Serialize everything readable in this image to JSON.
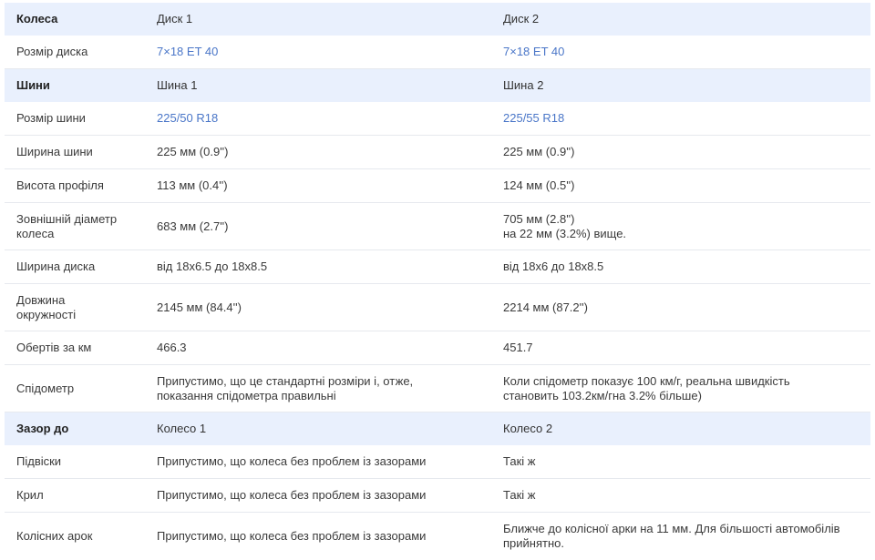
{
  "colors": {
    "header_bg": "#e9f0fd",
    "link": "#4a76c8",
    "text": "#3a3a3a",
    "divider": "#e6e9ee"
  },
  "sections": [
    {
      "header": [
        "Колеса",
        "Диск 1",
        "Диск 2"
      ],
      "rows": [
        {
          "label": [
            "Розмір диска"
          ],
          "v1": [
            "7×18 ET 40"
          ],
          "v2": [
            "7×18 ET 40"
          ],
          "link": true,
          "h": 37
        }
      ]
    },
    {
      "header": [
        "Шини",
        "Шина 1",
        "Шина 2"
      ],
      "rows": [
        {
          "label": [
            "Розмір шини"
          ],
          "v1": [
            "225/50 R18"
          ],
          "v2": [
            "225/55 R18"
          ],
          "link": true,
          "h": 37
        },
        {
          "label": [
            "Ширина шини"
          ],
          "v1": [
            "225 мм (0.9'')"
          ],
          "v2": [
            "225 мм (0.9'')"
          ],
          "h": 37
        },
        {
          "label": [
            "Висота профіля"
          ],
          "v1": [
            "113 мм (0.4'')"
          ],
          "v2": [
            "124 мм (0.5'')"
          ],
          "h": 37
        },
        {
          "label": [
            "Зовнішній діаметр",
            "колеса"
          ],
          "v1": [
            "683 мм (2.7'')"
          ],
          "v2": [
            "705 мм (2.8'')",
            "на 22 мм (3.2%) вище."
          ],
          "h": 52
        },
        {
          "label": [
            "Ширина диска"
          ],
          "v1": [
            "від 18x6.5 до 18x8.5"
          ],
          "v2": [
            "від 18x6 до 18x8.5"
          ],
          "h": 37
        },
        {
          "label": [
            "Довжина",
            "окружності"
          ],
          "v1": [
            "2145 мм (84.4'')"
          ],
          "v2": [
            "2214 мм (87.2'')"
          ],
          "h": 52
        },
        {
          "label": [
            "Обертів за км"
          ],
          "v1": [
            "466.3"
          ],
          "v2": [
            "451.7"
          ],
          "h": 37
        },
        {
          "label": [
            "Спідометр"
          ],
          "v1": [
            "Припустимо, що це стандартні розміри і, отже,",
            "показання спідометра правильні"
          ],
          "v2": [
            "Коли спідометр показує 100 км/г, реальна швидкість",
            "становить 103.2км/гна 3.2% більше)"
          ],
          "h": 52
        }
      ]
    },
    {
      "header": [
        "Зазор до",
        "Колесо 1",
        "Колесо 2"
      ],
      "rows": [
        {
          "label": [
            "Підвіски"
          ],
          "v1": [
            "Припустимо, що колеса без проблем із зазорами"
          ],
          "v2": [
            "Такі ж"
          ],
          "h": 37
        },
        {
          "label": [
            "Крил"
          ],
          "v1": [
            "Припустимо, що колеса без проблем із зазорами"
          ],
          "v2": [
            "Такі ж"
          ],
          "h": 37
        },
        {
          "label": [
            "Колісних арок"
          ],
          "v1": [
            "Припустимо, що колеса без проблем із зазорами"
          ],
          "v2": [
            "Ближче до колісної арки на 11 мм. Для більшості автомобілів",
            "прийнятно."
          ],
          "h": 52,
          "last": true
        }
      ]
    }
  ]
}
